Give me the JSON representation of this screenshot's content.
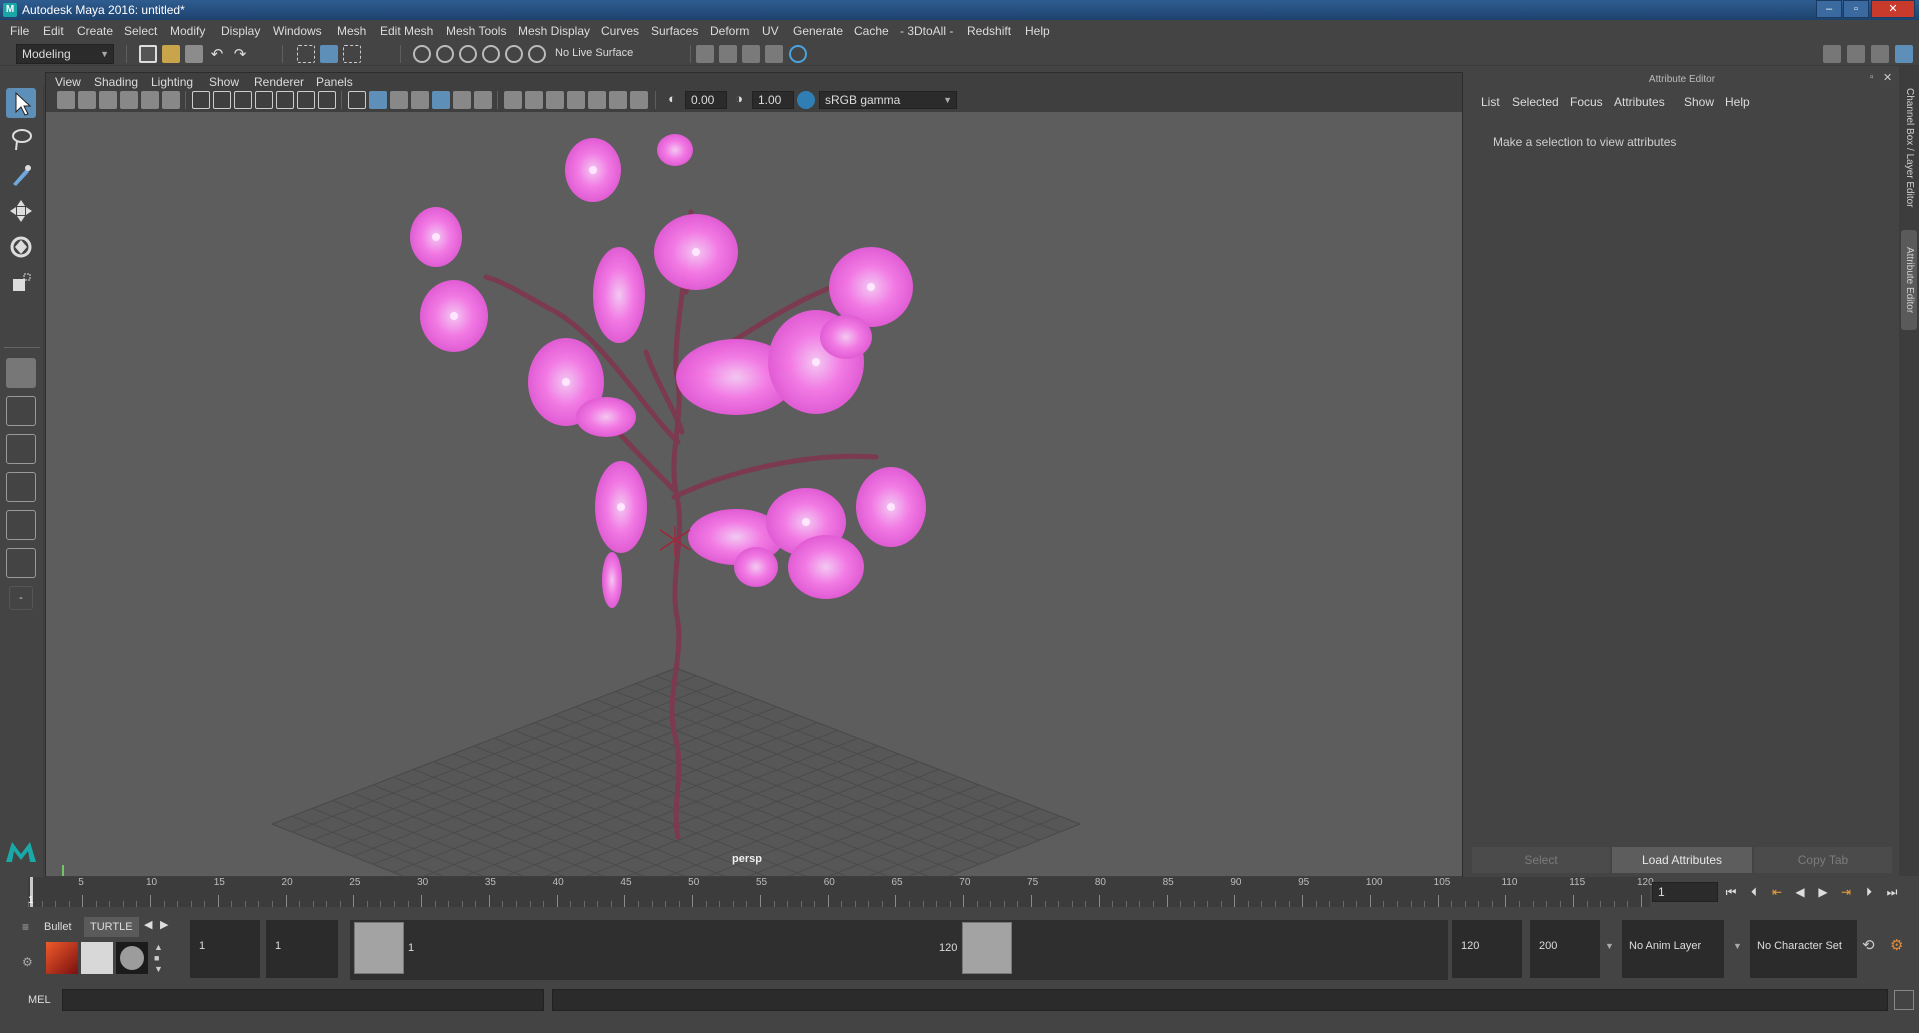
{
  "window": {
    "title": "Autodesk Maya 2016: untitled*",
    "controls": [
      "–",
      "▫",
      "✕"
    ]
  },
  "menubar": {
    "items": [
      "File",
      "Edit",
      "Create",
      "Select",
      "Modify",
      "Display",
      "Windows",
      "Mesh",
      "Edit Mesh",
      "Mesh Tools",
      "Mesh Display",
      "Curves",
      "Surfaces",
      "Deform",
      "UV",
      "Generate",
      "Cache",
      "- 3DtoAll -",
      "Redshift",
      "Help"
    ]
  },
  "statusline": {
    "mode": "Modeling",
    "live_surface": "No Live Surface"
  },
  "viewport": {
    "menu": [
      "View",
      "Shading",
      "Lighting",
      "Show",
      "Renderer",
      "Panels"
    ],
    "exposure": "0.00",
    "gamma": "1.00",
    "color_space": "sRGB gamma",
    "camera": "persp"
  },
  "attribute_editor": {
    "title": "Attribute Editor",
    "menu": [
      "List",
      "Selected",
      "Focus",
      "Attributes",
      "Show",
      "Help"
    ],
    "message": "Make a selection to view attributes",
    "buttons": [
      "Select",
      "Load Attributes",
      "Copy Tab"
    ],
    "side_tabs": [
      "Channel Box / Layer Editor",
      "Attribute Editor"
    ]
  },
  "timeline": {
    "ticks": [
      "1",
      "5",
      "10",
      "15",
      "20",
      "25",
      "30",
      "35",
      "40",
      "45",
      "50",
      "55",
      "60",
      "65",
      "70",
      "75",
      "80",
      "85",
      "90",
      "95",
      "100",
      "105",
      "110",
      "115",
      "120"
    ],
    "current_frame": "1"
  },
  "range": {
    "start": "1",
    "playback_start": "1",
    "slider_start": "1",
    "slider_end": "120",
    "playback_end": "120",
    "end": "200",
    "anim_layer": "No Anim Layer",
    "character_set": "No Character Set"
  },
  "shelf": {
    "tabs": [
      "Bullet",
      "TURTLE"
    ]
  },
  "cmdline": {
    "label": "MEL"
  }
}
